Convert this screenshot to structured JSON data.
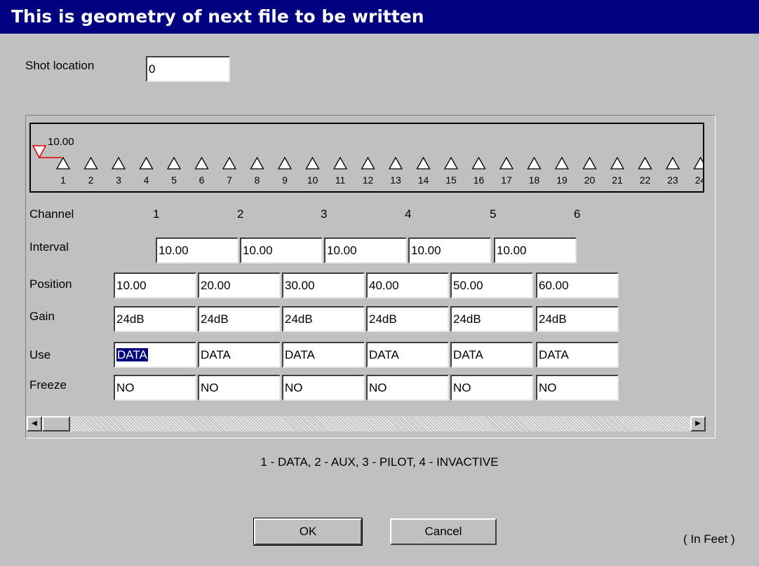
{
  "dialog": {
    "title": "This is geometry of next file to be written"
  },
  "shot": {
    "label": "Shot location",
    "value": "0"
  },
  "geometry": {
    "source_label": "10.00",
    "geophone_numbers": [
      "1",
      "2",
      "3",
      "4",
      "5",
      "6",
      "7",
      "8",
      "9",
      "10",
      "11",
      "12",
      "13",
      "14",
      "15",
      "16",
      "17",
      "18",
      "19",
      "20",
      "21",
      "22",
      "23",
      "24"
    ]
  },
  "table": {
    "row_labels": {
      "channel": "Channel",
      "interval": "Interval",
      "position": "Position",
      "gain": "Gain",
      "use": "Use",
      "freeze": "Freeze"
    },
    "channels": [
      "1",
      "2",
      "3",
      "4",
      "5",
      "6"
    ],
    "interval": [
      "10.00",
      "10.00",
      "10.00",
      "10.00",
      "10.00"
    ],
    "position": [
      "10.00",
      "20.00",
      "30.00",
      "40.00",
      "50.00",
      "60.00"
    ],
    "gain": [
      "24dB",
      "24dB",
      "24dB",
      "24dB",
      "24dB",
      "24dB"
    ],
    "use": [
      "DATA",
      "DATA",
      "DATA",
      "DATA",
      "DATA",
      "DATA"
    ],
    "freeze": [
      "NO",
      "NO",
      "NO",
      "NO",
      "NO",
      "NO"
    ]
  },
  "legend": "1 - DATA, 2 - AUX, 3 - PILOT, 4 - INVACTIVE",
  "buttons": {
    "ok": "OK",
    "cancel": "Cancel"
  },
  "units": "( In Feet )",
  "icons": {
    "scroll_left": "left-arrow-icon",
    "scroll_right": "right-arrow-icon",
    "source": "source-triangle-icon",
    "geophone": "geophone-triangle-icon"
  },
  "colors": {
    "title_bar": "#000080",
    "source_marker": "#e00000",
    "selection": "#000080"
  }
}
